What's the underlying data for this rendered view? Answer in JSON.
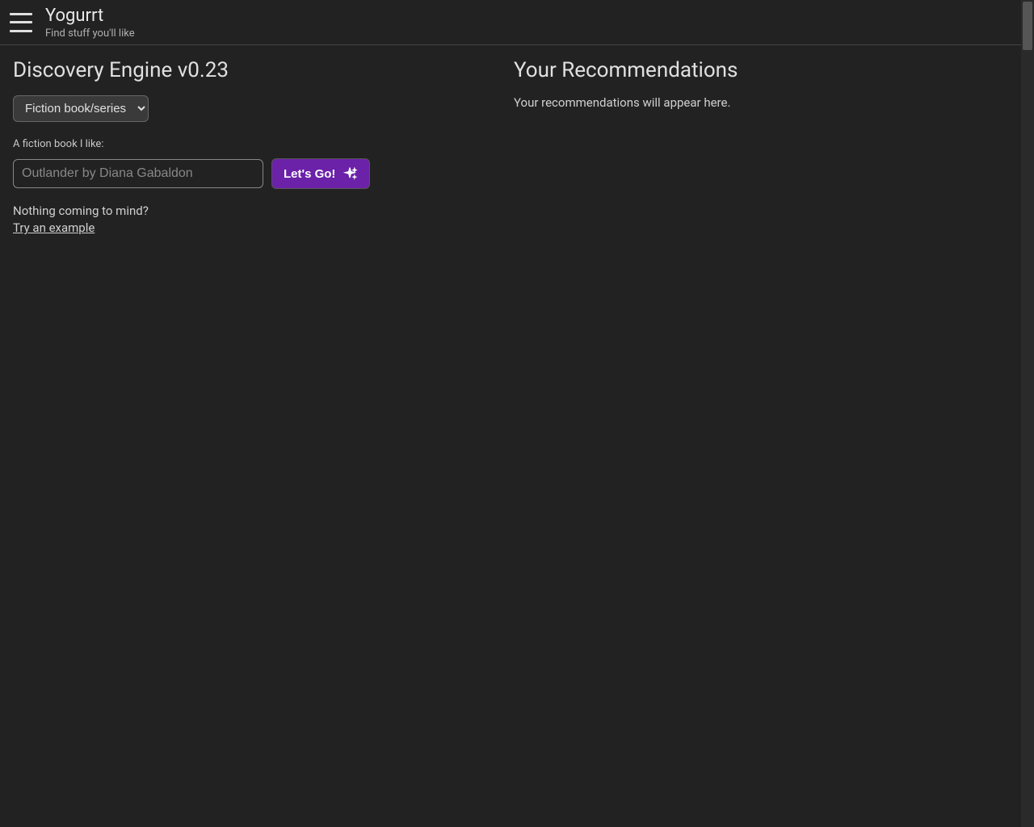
{
  "header": {
    "brand_title": "Yogurrt",
    "brand_subtitle": "Find stuff you'll like"
  },
  "left": {
    "heading": "Discovery Engine v0.23",
    "category_selected": "Fiction book/series",
    "input_label": "A fiction book I like:",
    "input_placeholder": "Outlander by Diana Gabaldon",
    "input_value": "",
    "go_button_label": "Let's Go!",
    "prompt_text": "Nothing coming to mind?",
    "example_link": "Try an example"
  },
  "right": {
    "heading": "Your Recommendations",
    "placeholder_text": "Your recommendations will appear here."
  },
  "colors": {
    "accent": "#6b21a8",
    "background": "#222222"
  }
}
